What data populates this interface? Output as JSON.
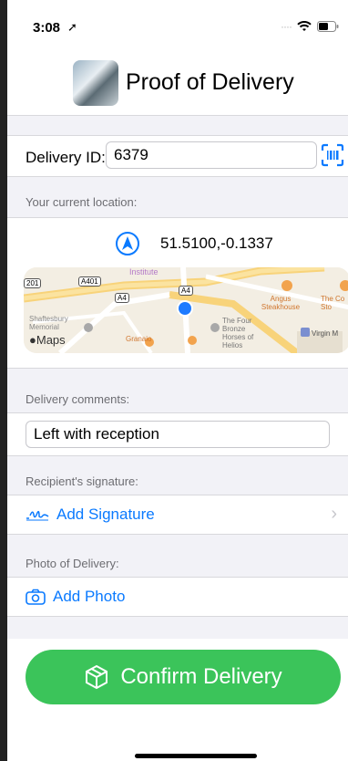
{
  "status_bar": {
    "time": "3:08"
  },
  "nav": {
    "title": "Proof of Delivery"
  },
  "delivery": {
    "id_label": "Delivery ID:",
    "id_value": "6379"
  },
  "location": {
    "section_label": "Your current location:",
    "coordinates": "51.5100,-0.1337"
  },
  "map": {
    "brand": "Maps",
    "labels": [
      "Institute",
      "A401",
      "A4",
      "A4",
      "201",
      "Shaftesbury Memorial",
      "Granaio",
      "Angus Steakhouse",
      "The Four Bronze Horses of Helios",
      "Virgin M",
      "The Co Sto"
    ]
  },
  "comments": {
    "section_label": "Delivery comments:",
    "value": "Left with reception"
  },
  "signature": {
    "section_label": "Recipient's signature:",
    "action_label": "Add Signature"
  },
  "photo": {
    "section_label": "Photo of Delivery:",
    "action_label": "Add Photo"
  },
  "confirm": {
    "label": "Confirm Delivery"
  },
  "colors": {
    "accent": "#0a7aff",
    "confirm_green": "#3bc45a",
    "location_dot": "#1e7bff"
  }
}
